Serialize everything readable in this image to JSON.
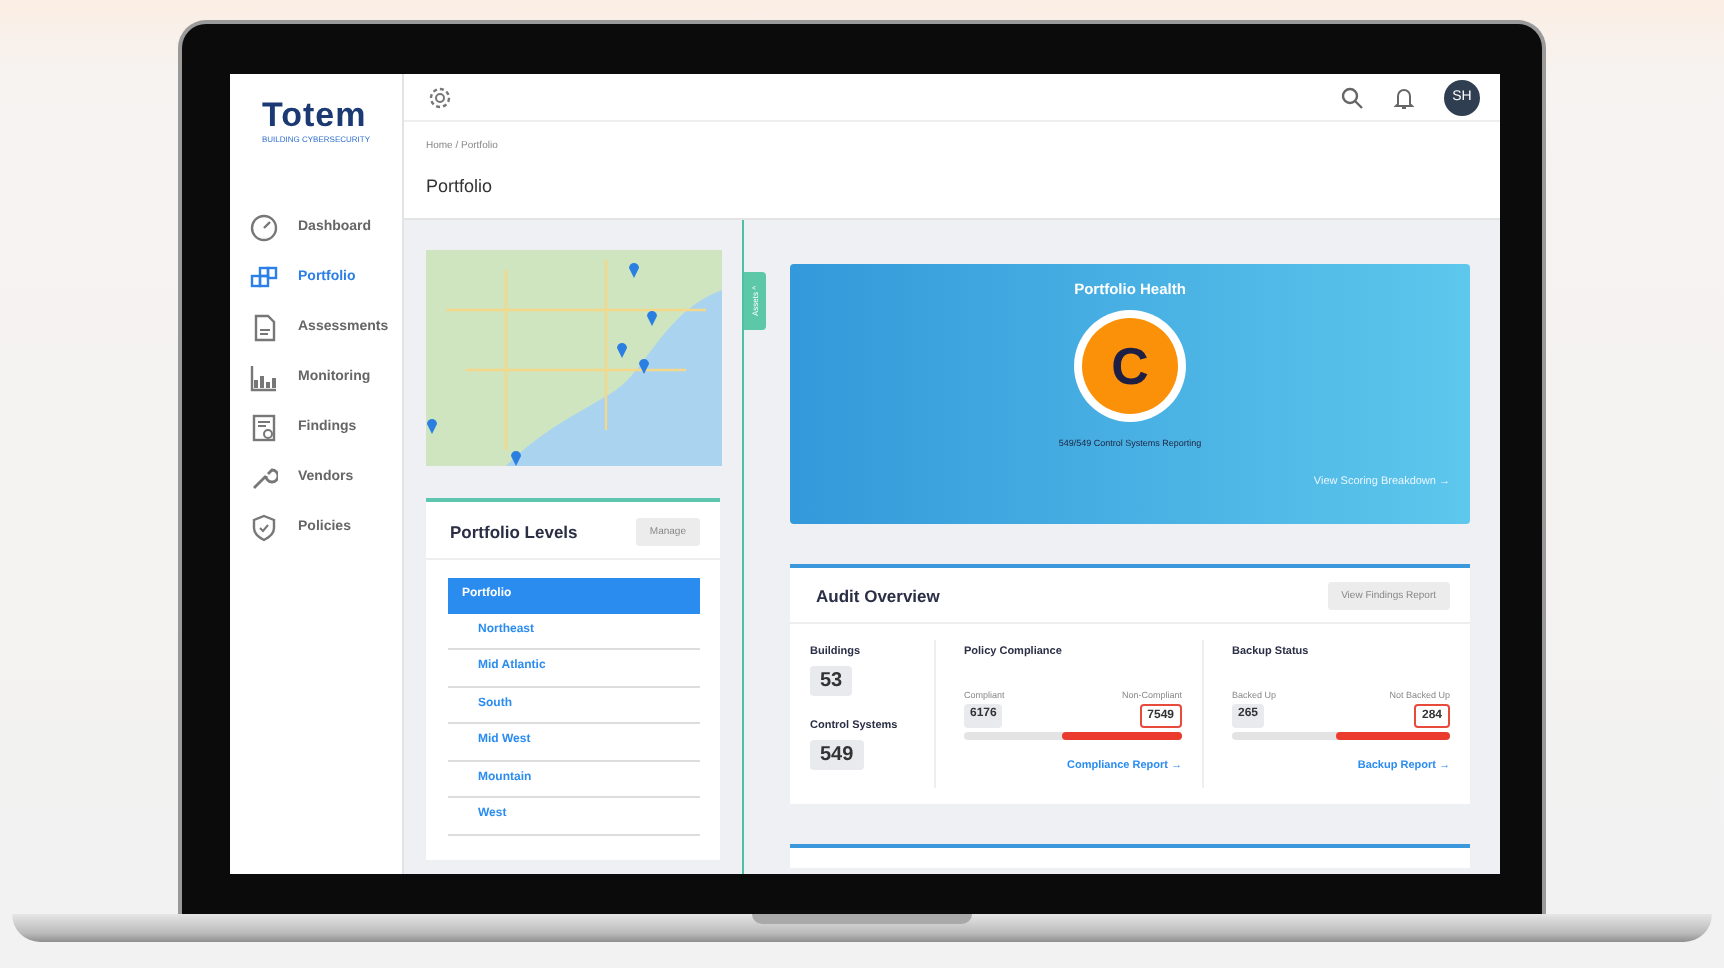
{
  "logo": {
    "name": "Totem",
    "tagline": "BUILDING CYBERSECURITY"
  },
  "sidebar": {
    "items": [
      {
        "label": "Dashboard",
        "selected": false
      },
      {
        "label": "Portfolio",
        "selected": true
      },
      {
        "label": "Assessments",
        "selected": false
      },
      {
        "label": "Monitoring",
        "selected": false
      },
      {
        "label": "Findings",
        "selected": false
      },
      {
        "label": "Vendors",
        "selected": false
      },
      {
        "label": "Policies",
        "selected": false
      }
    ]
  },
  "header": {
    "avatar": "SH"
  },
  "breadcrumb": "Home / Portfolio",
  "page_title": "Portfolio",
  "assets_tab": {
    "label": "Assets",
    "arrow": "^"
  },
  "portfolio_levels": {
    "title": "Portfolio Levels",
    "button": "Manage",
    "items": [
      {
        "label": "Portfolio",
        "selected": true,
        "children": [
          {
            "label": "Northeast",
            "selected": false
          },
          {
            "label": "Mid Atlantic",
            "selected": false
          },
          {
            "label": "South",
            "selected": false
          },
          {
            "label": "Mid West",
            "selected": false
          },
          {
            "label": "Mountain",
            "selected": false
          },
          {
            "label": "West",
            "selected": false
          }
        ]
      }
    ]
  },
  "portfolio_health": {
    "title": "Portfolio Health",
    "grade": "C",
    "reporting": "549/549 Control Systems Reporting",
    "link": "View Scoring Breakdown →"
  },
  "audit_overview": {
    "title": "Audit Overview",
    "button": "View Findings Report",
    "counts": [
      {
        "label": "Buildings",
        "value": "53"
      },
      {
        "label": "Control Systems",
        "value": "549"
      }
    ],
    "sections": [
      {
        "title": "Policy Compliance",
        "left_label": "Compliant",
        "left_value": "6176",
        "right_label": "Non-Compliant",
        "right_value": "7549",
        "level": 0.55,
        "link": "Compliance Report →"
      },
      {
        "title": "Backup Status",
        "left_label": "Backed Up",
        "left_value": "265",
        "right_label": "Not Backed Up",
        "right_value": "284",
        "level": 0.52,
        "link": "Backup Report →"
      }
    ]
  }
}
